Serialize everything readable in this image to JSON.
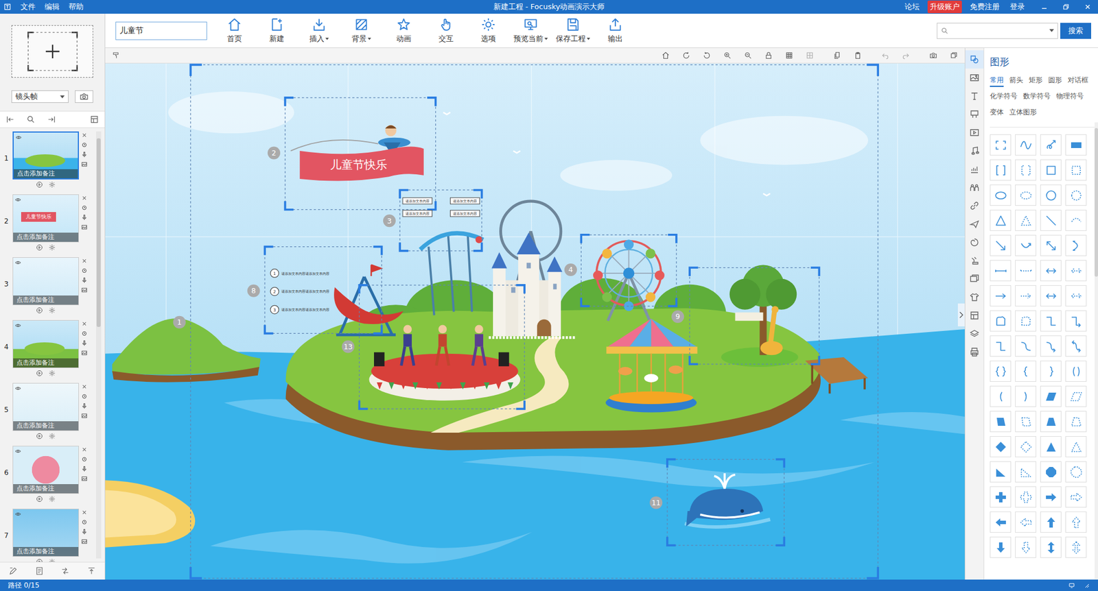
{
  "window": {
    "title": "新建工程 - Focusky动画演示大师",
    "menus": [
      "文件",
      "编辑",
      "帮助"
    ],
    "links": [
      {
        "label": "论坛",
        "highlight": false
      },
      {
        "label": "升级账户",
        "highlight": true
      },
      {
        "label": "免费注册",
        "highlight": false
      },
      {
        "label": "登录",
        "highlight": false
      }
    ]
  },
  "toolbar": {
    "project_name": "儿童节",
    "buttons": [
      {
        "label": "首页",
        "dropdown": false
      },
      {
        "label": "新建",
        "dropdown": false
      },
      {
        "label": "插入",
        "dropdown": true
      },
      {
        "label": "背景",
        "dropdown": true
      },
      {
        "label": "动画",
        "dropdown": false
      },
      {
        "label": "交互",
        "dropdown": false
      },
      {
        "label": "选项",
        "dropdown": false
      },
      {
        "label": "预览当前",
        "dropdown": true
      },
      {
        "label": "保存工程",
        "dropdown": true
      },
      {
        "label": "输出",
        "dropdown": false
      }
    ],
    "search_button": "搜索"
  },
  "frames_panel": {
    "frame_type": "镜头帧",
    "thumbnails": [
      {
        "number": "1",
        "note": "点击添加备注",
        "selected": true,
        "text": ""
      },
      {
        "number": "2",
        "note": "点击添加备注",
        "selected": false,
        "text": "儿童节快乐"
      },
      {
        "number": "3",
        "note": "点击添加备注",
        "selected": false,
        "text": ""
      },
      {
        "number": "4",
        "note": "点击添加备注",
        "selected": false,
        "text": ""
      },
      {
        "number": "5",
        "note": "点击添加备注",
        "selected": false,
        "text": ""
      },
      {
        "number": "6",
        "note": "点击添加备注",
        "selected": false,
        "text": ""
      },
      {
        "number": "7",
        "note": "点击添加备注",
        "selected": false,
        "text": ""
      }
    ]
  },
  "canvas": {
    "banner": "儿童节快乐",
    "frames": [
      {
        "number": "1",
        "items": []
      },
      {
        "number": "2",
        "items": []
      },
      {
        "number": "3",
        "items": [
          {
            "number": "",
            "text": "请添加文本内容"
          },
          {
            "number": "",
            "text": "请添加文本内容"
          },
          {
            "number": "",
            "text": "请添加文本内容"
          },
          {
            "number": "",
            "text": "请添加文本内容"
          }
        ]
      },
      {
        "number": "4",
        "items": []
      },
      {
        "number": "8",
        "items": [
          {
            "number": "1",
            "text": "请添加文本内容请添加文本内容"
          },
          {
            "number": "2",
            "text": "请添加文本内容请添加文本内容"
          },
          {
            "number": "3",
            "text": "请添加文本内容请添加文本内容"
          }
        ]
      },
      {
        "number": "9",
        "items": []
      },
      {
        "number": "11",
        "items": []
      },
      {
        "number": "13",
        "items": []
      }
    ]
  },
  "shapes_panel": {
    "title": "图形",
    "tabs": [
      {
        "label": "常用",
        "selected": true
      },
      {
        "label": "箭头",
        "selected": false
      },
      {
        "label": "矩形",
        "selected": false
      },
      {
        "label": "圆形",
        "selected": false
      },
      {
        "label": "对话框",
        "selected": false
      },
      {
        "label": "化学符号",
        "selected": false
      },
      {
        "label": "数学符号",
        "selected": false
      },
      {
        "label": "物理符号",
        "selected": false
      },
      {
        "label": "变体",
        "selected": false
      },
      {
        "label": "立体图形",
        "selected": false
      }
    ]
  },
  "status_bar": {
    "path": "路径 0/15"
  }
}
